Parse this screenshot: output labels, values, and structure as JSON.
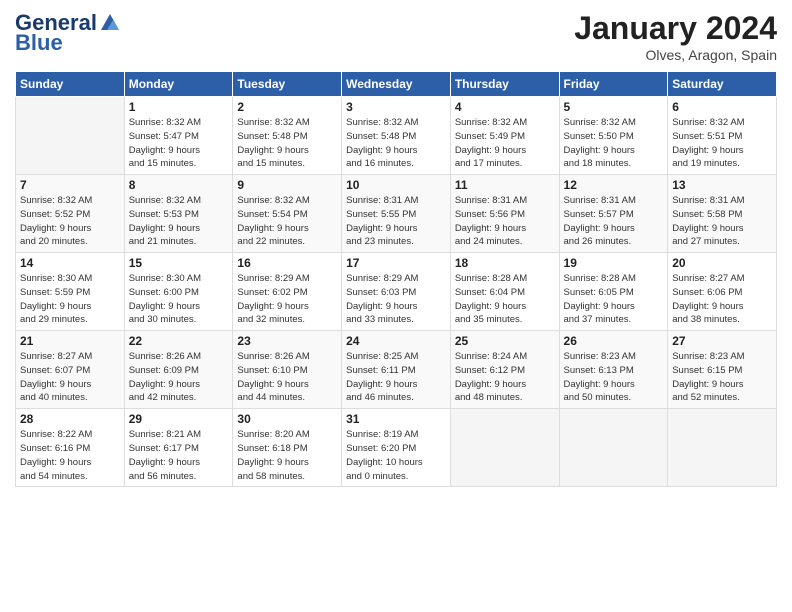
{
  "logo": {
    "text_general": "General",
    "text_blue": "Blue"
  },
  "title": "January 2024",
  "location": "Olves, Aragon, Spain",
  "days_header": [
    "Sunday",
    "Monday",
    "Tuesday",
    "Wednesday",
    "Thursday",
    "Friday",
    "Saturday"
  ],
  "weeks": [
    [
      {
        "day": "",
        "info": ""
      },
      {
        "day": "1",
        "info": "Sunrise: 8:32 AM\nSunset: 5:47 PM\nDaylight: 9 hours\nand 15 minutes."
      },
      {
        "day": "2",
        "info": "Sunrise: 8:32 AM\nSunset: 5:48 PM\nDaylight: 9 hours\nand 15 minutes."
      },
      {
        "day": "3",
        "info": "Sunrise: 8:32 AM\nSunset: 5:48 PM\nDaylight: 9 hours\nand 16 minutes."
      },
      {
        "day": "4",
        "info": "Sunrise: 8:32 AM\nSunset: 5:49 PM\nDaylight: 9 hours\nand 17 minutes."
      },
      {
        "day": "5",
        "info": "Sunrise: 8:32 AM\nSunset: 5:50 PM\nDaylight: 9 hours\nand 18 minutes."
      },
      {
        "day": "6",
        "info": "Sunrise: 8:32 AM\nSunset: 5:51 PM\nDaylight: 9 hours\nand 19 minutes."
      }
    ],
    [
      {
        "day": "7",
        "info": "Sunrise: 8:32 AM\nSunset: 5:52 PM\nDaylight: 9 hours\nand 20 minutes."
      },
      {
        "day": "8",
        "info": "Sunrise: 8:32 AM\nSunset: 5:53 PM\nDaylight: 9 hours\nand 21 minutes."
      },
      {
        "day": "9",
        "info": "Sunrise: 8:32 AM\nSunset: 5:54 PM\nDaylight: 9 hours\nand 22 minutes."
      },
      {
        "day": "10",
        "info": "Sunrise: 8:31 AM\nSunset: 5:55 PM\nDaylight: 9 hours\nand 23 minutes."
      },
      {
        "day": "11",
        "info": "Sunrise: 8:31 AM\nSunset: 5:56 PM\nDaylight: 9 hours\nand 24 minutes."
      },
      {
        "day": "12",
        "info": "Sunrise: 8:31 AM\nSunset: 5:57 PM\nDaylight: 9 hours\nand 26 minutes."
      },
      {
        "day": "13",
        "info": "Sunrise: 8:31 AM\nSunset: 5:58 PM\nDaylight: 9 hours\nand 27 minutes."
      }
    ],
    [
      {
        "day": "14",
        "info": "Sunrise: 8:30 AM\nSunset: 5:59 PM\nDaylight: 9 hours\nand 29 minutes."
      },
      {
        "day": "15",
        "info": "Sunrise: 8:30 AM\nSunset: 6:00 PM\nDaylight: 9 hours\nand 30 minutes."
      },
      {
        "day": "16",
        "info": "Sunrise: 8:29 AM\nSunset: 6:02 PM\nDaylight: 9 hours\nand 32 minutes."
      },
      {
        "day": "17",
        "info": "Sunrise: 8:29 AM\nSunset: 6:03 PM\nDaylight: 9 hours\nand 33 minutes."
      },
      {
        "day": "18",
        "info": "Sunrise: 8:28 AM\nSunset: 6:04 PM\nDaylight: 9 hours\nand 35 minutes."
      },
      {
        "day": "19",
        "info": "Sunrise: 8:28 AM\nSunset: 6:05 PM\nDaylight: 9 hours\nand 37 minutes."
      },
      {
        "day": "20",
        "info": "Sunrise: 8:27 AM\nSunset: 6:06 PM\nDaylight: 9 hours\nand 38 minutes."
      }
    ],
    [
      {
        "day": "21",
        "info": "Sunrise: 8:27 AM\nSunset: 6:07 PM\nDaylight: 9 hours\nand 40 minutes."
      },
      {
        "day": "22",
        "info": "Sunrise: 8:26 AM\nSunset: 6:09 PM\nDaylight: 9 hours\nand 42 minutes."
      },
      {
        "day": "23",
        "info": "Sunrise: 8:26 AM\nSunset: 6:10 PM\nDaylight: 9 hours\nand 44 minutes."
      },
      {
        "day": "24",
        "info": "Sunrise: 8:25 AM\nSunset: 6:11 PM\nDaylight: 9 hours\nand 46 minutes."
      },
      {
        "day": "25",
        "info": "Sunrise: 8:24 AM\nSunset: 6:12 PM\nDaylight: 9 hours\nand 48 minutes."
      },
      {
        "day": "26",
        "info": "Sunrise: 8:23 AM\nSunset: 6:13 PM\nDaylight: 9 hours\nand 50 minutes."
      },
      {
        "day": "27",
        "info": "Sunrise: 8:23 AM\nSunset: 6:15 PM\nDaylight: 9 hours\nand 52 minutes."
      }
    ],
    [
      {
        "day": "28",
        "info": "Sunrise: 8:22 AM\nSunset: 6:16 PM\nDaylight: 9 hours\nand 54 minutes."
      },
      {
        "day": "29",
        "info": "Sunrise: 8:21 AM\nSunset: 6:17 PM\nDaylight: 9 hours\nand 56 minutes."
      },
      {
        "day": "30",
        "info": "Sunrise: 8:20 AM\nSunset: 6:18 PM\nDaylight: 9 hours\nand 58 minutes."
      },
      {
        "day": "31",
        "info": "Sunrise: 8:19 AM\nSunset: 6:20 PM\nDaylight: 10 hours\nand 0 minutes."
      },
      {
        "day": "",
        "info": ""
      },
      {
        "day": "",
        "info": ""
      },
      {
        "day": "",
        "info": ""
      }
    ]
  ]
}
